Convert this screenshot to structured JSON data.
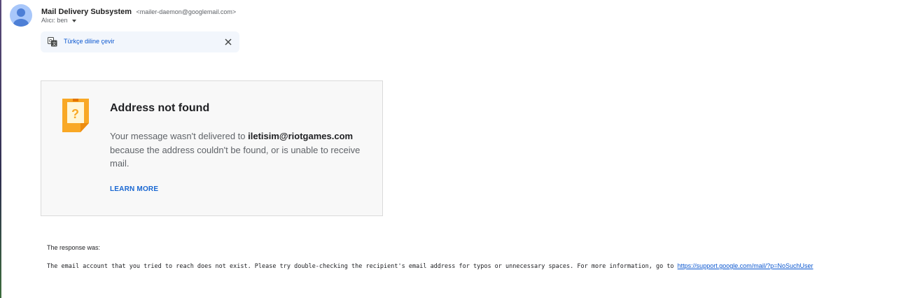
{
  "header": {
    "sender_name": "Mail Delivery Subsystem",
    "sender_email": "<mailer-daemon@googlemail.com>",
    "recipient_label": "Alıcı: ben"
  },
  "translate_bar": {
    "label": "Türkçe diline çevir",
    "icon": "translate-icon",
    "close_icon": "close-icon"
  },
  "card": {
    "icon": "missing-address-icon",
    "title": "Address not found",
    "body_prefix": "Your message wasn't delivered to ",
    "address": "iletisim@riotgames.com",
    "body_suffix": "because the address couldn't be found, or is unable to receive mail.",
    "learn_more": "LEARN MORE"
  },
  "response": {
    "label": "The response was:",
    "text": "The email account that you tried to reach does not exist. Please try double-checking the recipient's email address for typos or unnecessary spaces. For more information, go to ",
    "link": "https://support.google.com/mail/?p=NoSuchUser"
  },
  "colors": {
    "link": "#0b57d0",
    "avatar": "#a8c7fa",
    "notice_orange": "#f9a825"
  }
}
